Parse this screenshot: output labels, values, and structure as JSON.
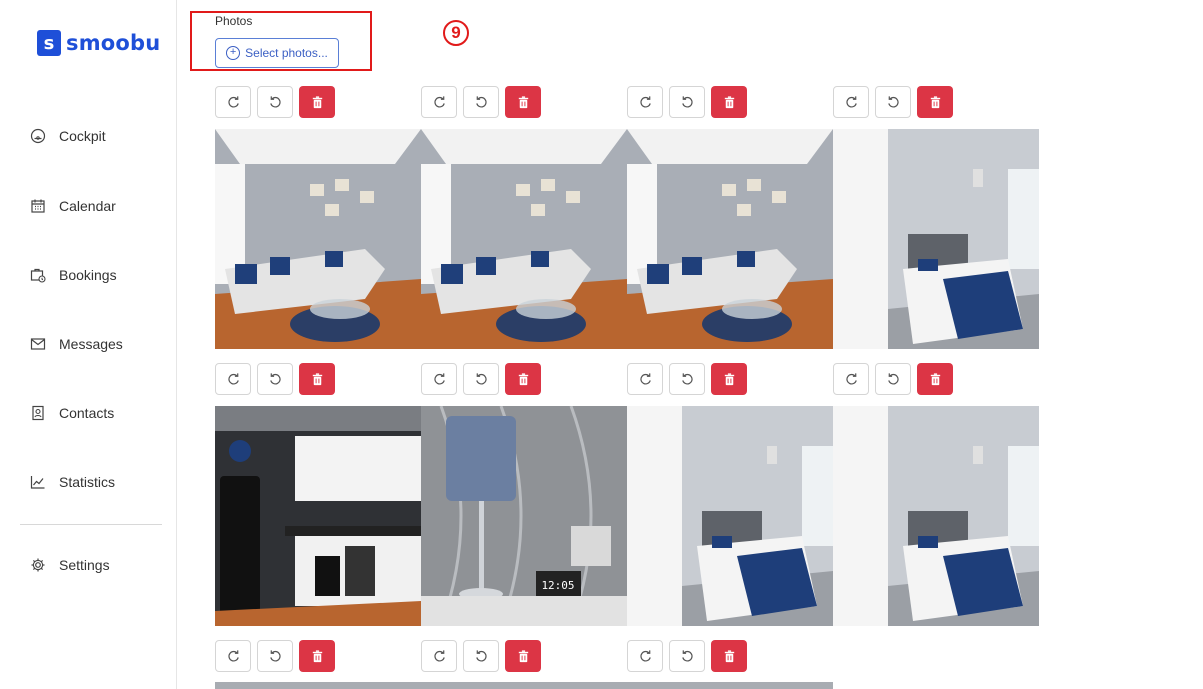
{
  "brand": {
    "name": "smoobu",
    "mark": "s",
    "color": "#1e4fd8",
    "accent": "#22c07a"
  },
  "sidebar": {
    "items": [
      {
        "label": "Cockpit",
        "icon": "cockpit-icon"
      },
      {
        "label": "Calendar",
        "icon": "calendar-icon"
      },
      {
        "label": "Bookings",
        "icon": "bookings-icon"
      },
      {
        "label": "Messages",
        "icon": "envelope-icon"
      },
      {
        "label": "Contacts",
        "icon": "contacts-icon"
      },
      {
        "label": "Statistics",
        "icon": "chart-icon"
      },
      {
        "label": "Settings",
        "icon": "gear-icon"
      }
    ]
  },
  "photos": {
    "label": "Photos",
    "select_button": "Select photos...",
    "annotation_step": "9",
    "annotation_color": "#e11a1a",
    "delete_color": "#dc3545",
    "controls": [
      "rotate-right-icon",
      "rotate-left-icon",
      "trash-icon"
    ],
    "items": [
      {
        "scene": "living room with sectional sofa"
      },
      {
        "scene": "living room with sofa and wall TV"
      },
      {
        "scene": "living room with window and sofa"
      },
      {
        "scene": "bedroom with wardrobe and bed"
      },
      {
        "scene": "kitchen with black fridge"
      },
      {
        "scene": "bedside lamp with alarm clock",
        "clock_text": "12:05"
      },
      {
        "scene": "bedroom with wardrobe and bed"
      },
      {
        "scene": "bedroom with bed and window"
      },
      {
        "scene": "partial photo"
      },
      {
        "scene": "partial photo"
      },
      {
        "scene": "partial photo"
      }
    ]
  }
}
